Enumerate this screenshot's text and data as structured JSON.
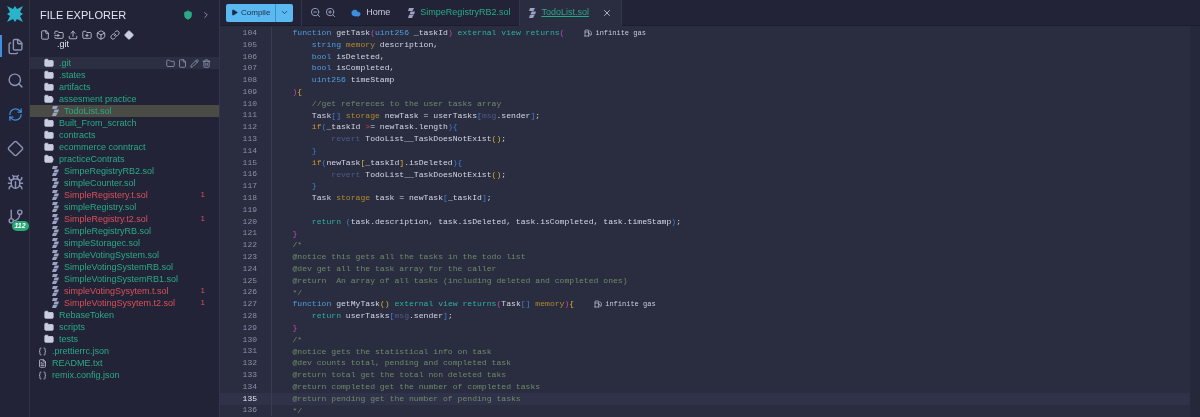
{
  "activity_bar": {
    "items": [
      {
        "kind": "files",
        "selected": true
      },
      {
        "kind": "search",
        "selected": false
      },
      {
        "kind": "compile",
        "selected": false
      },
      {
        "kind": "deploy",
        "selected": false
      },
      {
        "kind": "debug",
        "selected": false
      },
      {
        "kind": "git",
        "selected": false,
        "badge": "112"
      }
    ]
  },
  "sidebar": {
    "title": "FILE EXPLORER",
    "drag_label": ".git",
    "tree": [
      {
        "name": ".git",
        "kind": "folder",
        "expanded": false,
        "selected": false,
        "hovered": true
      },
      {
        "name": ".states",
        "kind": "folder",
        "expanded": false,
        "selected": false,
        "hovered": false
      },
      {
        "name": "artifacts",
        "kind": "folder",
        "expanded": false,
        "selected": false,
        "hovered": false
      },
      {
        "name": "assesment practice",
        "kind": "folder",
        "expanded": true,
        "selected": false,
        "hovered": false,
        "children": [
          {
            "name": "TodoList.sol",
            "kind": "sol",
            "selected": true,
            "hovered": false
          }
        ]
      },
      {
        "name": "Built_From_scratch",
        "kind": "folder",
        "expanded": false,
        "selected": false,
        "hovered": false
      },
      {
        "name": "contracts",
        "kind": "folder",
        "expanded": false,
        "selected": false,
        "hovered": false
      },
      {
        "name": "ecommerce conntract",
        "kind": "folder",
        "expanded": false,
        "selected": false,
        "hovered": false
      },
      {
        "name": "practiceContrats",
        "kind": "folder",
        "expanded": true,
        "selected": false,
        "hovered": false,
        "children": [
          {
            "name": "SimpeRegistryRB2.sol",
            "kind": "sol",
            "selected": false,
            "hovered": false
          },
          {
            "name": "simpleCounter.sol",
            "kind": "sol",
            "selected": false,
            "hovered": false
          },
          {
            "name": "SimpleRegistery.t.sol",
            "kind": "sol",
            "selected": false,
            "hovered": false,
            "errors": "1"
          },
          {
            "name": "simpleRegistry.sol",
            "kind": "sol",
            "selected": false,
            "hovered": false
          },
          {
            "name": "SimpleRegistry.t2.sol",
            "kind": "sol",
            "selected": false,
            "hovered": false,
            "errors": "1"
          },
          {
            "name": "SimpleRegistryRB.sol",
            "kind": "sol",
            "selected": false,
            "hovered": false
          },
          {
            "name": "simpleStoragec.sol",
            "kind": "sol",
            "selected": false,
            "hovered": false
          },
          {
            "name": "simpleVotingSystem.sol",
            "kind": "sol",
            "selected": false,
            "hovered": false
          },
          {
            "name": "SimpleVotingSystemRB.sol",
            "kind": "sol",
            "selected": false,
            "hovered": false
          },
          {
            "name": "SimpleVotingSystemRB1.sol",
            "kind": "sol",
            "selected": false,
            "hovered": false
          },
          {
            "name": "simpleVotingSysytem.t.sol",
            "kind": "sol",
            "selected": false,
            "hovered": false,
            "errors": "1"
          },
          {
            "name": "SimpleVotingSysytem.t2.sol",
            "kind": "sol",
            "selected": false,
            "hovered": false,
            "errors": "1"
          }
        ]
      },
      {
        "name": "RebaseToken",
        "kind": "folder",
        "expanded": false,
        "selected": false,
        "hovered": false
      },
      {
        "name": "scripts",
        "kind": "folder",
        "expanded": false,
        "selected": false,
        "hovered": false
      },
      {
        "name": "tests",
        "kind": "folder",
        "expanded": false,
        "selected": false,
        "hovered": false
      },
      {
        "name": ".prettierrc.json",
        "kind": "json",
        "selected": false,
        "hovered": false
      },
      {
        "name": "README.txt",
        "kind": "txt",
        "selected": false,
        "hovered": false
      },
      {
        "name": "remix.config.json",
        "kind": "json",
        "selected": false,
        "hovered": false
      }
    ]
  },
  "toolbar": {
    "compile_button": "Compile"
  },
  "tabs": [
    {
      "label": "Home",
      "kind": "home",
      "selected": false,
      "closable": false
    },
    {
      "label": "SimpeRegistryRB2.sol",
      "kind": "sol",
      "selected": false,
      "closable": false
    },
    {
      "label": "TodoList.sol",
      "kind": "sol",
      "selected": true,
      "closable": true
    }
  ],
  "code": [
    {
      "number": "104",
      "current": false,
      "gas": "infinite gas",
      "tokens": [
        {
          "text": "    function",
          "kind": "kw"
        },
        {
          "text": " getTask",
          "kind": "t"
        },
        {
          "text": "(",
          "kind": "p1"
        },
        {
          "text": "uint256",
          "kind": "kw"
        },
        {
          "text": " _taskId",
          "kind": "t"
        },
        {
          "text": ")",
          "kind": "p1"
        },
        {
          "text": " external view returns",
          "kind": "mod"
        },
        {
          "text": "(",
          "kind": "p1"
        }
      ]
    },
    {
      "number": "105",
      "current": false,
      "tokens": [
        {
          "text": "        string",
          "kind": "kw"
        },
        {
          "text": " memory",
          "kind": "loc"
        },
        {
          "text": " description,",
          "kind": "t"
        }
      ]
    },
    {
      "number": "106",
      "current": false,
      "tokens": [
        {
          "text": "        bool",
          "kind": "kw"
        },
        {
          "text": " isDeleted,",
          "kind": "t"
        }
      ]
    },
    {
      "number": "107",
      "current": false,
      "tokens": [
        {
          "text": "        bool",
          "kind": "kw"
        },
        {
          "text": " isCompleted,",
          "kind": "t"
        }
      ]
    },
    {
      "number": "108",
      "current": false,
      "tokens": [
        {
          "text": "        uint256",
          "kind": "kw"
        },
        {
          "text": " timeStamp",
          "kind": "t"
        }
      ]
    },
    {
      "number": "109",
      "current": false,
      "tokens": [
        {
          "text": "    )",
          "kind": "p1"
        },
        {
          "text": "{",
          "kind": "p3"
        }
      ]
    },
    {
      "number": "110",
      "current": false,
      "tokens": [
        {
          "text": "        //get refereces to the user tasks array",
          "kind": "cm"
        }
      ]
    },
    {
      "number": "111",
      "current": false,
      "tokens": [
        {
          "text": "        Task",
          "kind": "t"
        },
        {
          "text": "[]",
          "kind": "p2"
        },
        {
          "text": " storage",
          "kind": "loc"
        },
        {
          "text": " newTask = userTasks",
          "kind": "t"
        },
        {
          "text": "[",
          "kind": "p2"
        },
        {
          "text": "msg",
          "kind": "dim"
        },
        {
          "text": ".sender",
          "kind": "t"
        },
        {
          "text": "]",
          "kind": "p2"
        },
        {
          "text": ";",
          "kind": "t"
        }
      ]
    },
    {
      "number": "112",
      "current": false,
      "tokens": [
        {
          "text": "        if",
          "kind": "ctl"
        },
        {
          "text": "(",
          "kind": "p2"
        },
        {
          "text": "_taskId ",
          "kind": "t"
        },
        {
          "text": ">",
          "kind": "err"
        },
        {
          "text": "= newTask.length",
          "kind": "t"
        },
        {
          "text": ")",
          "kind": "p2"
        },
        {
          "text": "{",
          "kind": "p2"
        }
      ]
    },
    {
      "number": "113",
      "current": false,
      "tokens": [
        {
          "text": "            revert",
          "kind": "dim"
        },
        {
          "text": " TodoList__TaskDoesNotExist",
          "kind": "t"
        },
        {
          "text": "()",
          "kind": "p3"
        },
        {
          "text": ";",
          "kind": "t"
        }
      ]
    },
    {
      "number": "114",
      "current": false,
      "tokens": [
        {
          "text": "        }",
          "kind": "p2"
        }
      ]
    },
    {
      "number": "115",
      "current": false,
      "tokens": [
        {
          "text": "        if",
          "kind": "ctl"
        },
        {
          "text": "(",
          "kind": "p2"
        },
        {
          "text": "newTask",
          "kind": "t"
        },
        {
          "text": "[",
          "kind": "p3"
        },
        {
          "text": "_taskId",
          "kind": "t"
        },
        {
          "text": "]",
          "kind": "p3"
        },
        {
          "text": ".isDeleted",
          "kind": "t"
        },
        {
          "text": ")",
          "kind": "p2"
        },
        {
          "text": "{",
          "kind": "p2"
        }
      ]
    },
    {
      "number": "116",
      "current": false,
      "tokens": [
        {
          "text": "            revert",
          "kind": "dim"
        },
        {
          "text": " TodoList__TaskDoesNotExist",
          "kind": "t"
        },
        {
          "text": "()",
          "kind": "p3"
        },
        {
          "text": ";",
          "kind": "t"
        }
      ]
    },
    {
      "number": "117",
      "current": false,
      "tokens": [
        {
          "text": "        }",
          "kind": "p2"
        }
      ]
    },
    {
      "number": "118",
      "current": false,
      "tokens": [
        {
          "text": "        Task ",
          "kind": "t"
        },
        {
          "text": "storage",
          "kind": "loc"
        },
        {
          "text": " task = newTask",
          "kind": "t"
        },
        {
          "text": "[",
          "kind": "p2"
        },
        {
          "text": "_taskId",
          "kind": "t"
        },
        {
          "text": "]",
          "kind": "p2"
        },
        {
          "text": ";",
          "kind": "t"
        }
      ]
    },
    {
      "number": "119",
      "current": false
    },
    {
      "number": "120",
      "current": false,
      "tokens": [
        {
          "text": "        return",
          "kind": "mod"
        },
        {
          "text": " (",
          "kind": "p2"
        },
        {
          "text": "task.description, task.isDeleted, task.isCompleted, task.timeStamp",
          "kind": "t"
        },
        {
          "text": ")",
          "kind": "p2"
        },
        {
          "text": ";",
          "kind": "t"
        }
      ]
    },
    {
      "number": "121",
      "current": false,
      "tokens": [
        {
          "text": "    }",
          "kind": "p1"
        }
      ]
    },
    {
      "number": "122",
      "current": false,
      "tokens": [
        {
          "text": "    /*",
          "kind": "cm"
        }
      ]
    },
    {
      "number": "123",
      "current": false,
      "tokens": [
        {
          "text": "    @notice this gets all the tasks in the todo list",
          "kind": "cm"
        }
      ]
    },
    {
      "number": "124",
      "current": false,
      "tokens": [
        {
          "text": "    @dev get all the task array for the caller",
          "kind": "cm"
        }
      ]
    },
    {
      "number": "125",
      "current": false,
      "tokens": [
        {
          "text": "    @return  An array of all tasks (including deleted and completed ones)",
          "kind": "cm"
        }
      ]
    },
    {
      "number": "126",
      "current": false,
      "tokens": [
        {
          "text": "    */",
          "kind": "cm"
        }
      ]
    },
    {
      "number": "127",
      "current": false,
      "gas": "infinite gas",
      "tokens": [
        {
          "text": "    function",
          "kind": "kw"
        },
        {
          "text": " getMyTask",
          "kind": "t"
        },
        {
          "text": "()",
          "kind": "p3"
        },
        {
          "text": " external view returns",
          "kind": "mod"
        },
        {
          "text": "(",
          "kind": "p1"
        },
        {
          "text": "Task",
          "kind": "t"
        },
        {
          "text": "[]",
          "kind": "p2"
        },
        {
          "text": " memory",
          "kind": "loc"
        },
        {
          "text": ")",
          "kind": "p1"
        },
        {
          "text": "{",
          "kind": "p3"
        }
      ]
    },
    {
      "number": "128",
      "current": false,
      "tokens": [
        {
          "text": "        return",
          "kind": "mod"
        },
        {
          "text": " userTasks",
          "kind": "t"
        },
        {
          "text": "[",
          "kind": "p2"
        },
        {
          "text": "msg",
          "kind": "dim"
        },
        {
          "text": ".sender",
          "kind": "t"
        },
        {
          "text": "]",
          "kind": "p2"
        },
        {
          "text": ";",
          "kind": "t"
        }
      ]
    },
    {
      "number": "129",
      "current": false,
      "tokens": [
        {
          "text": "    }",
          "kind": "p1"
        }
      ]
    },
    {
      "number": "130",
      "current": false,
      "tokens": [
        {
          "text": "    /*",
          "kind": "cm"
        }
      ]
    },
    {
      "number": "131",
      "current": false,
      "tokens": [
        {
          "text": "    @notice gets the statistical info on task",
          "kind": "cm"
        }
      ]
    },
    {
      "number": "132",
      "current": false,
      "tokens": [
        {
          "text": "    @dev counts total, pending and completed task",
          "kind": "cm"
        }
      ]
    },
    {
      "number": "133",
      "current": false,
      "tokens": [
        {
          "text": "    @return total get the total non deleted taks",
          "kind": "cm"
        }
      ]
    },
    {
      "number": "134",
      "current": false,
      "tokens": [
        {
          "text": "    @return completed get the number of completed tasks",
          "kind": "cm"
        }
      ]
    },
    {
      "number": "135",
      "current": true,
      "tokens": [
        {
          "text": "    @return pending get the number of pending tasks",
          "kind": "cm"
        }
      ]
    },
    {
      "number": "136",
      "current": false,
      "tokens": [
        {
          "text": "    */",
          "kind": "cm"
        }
      ]
    }
  ]
}
